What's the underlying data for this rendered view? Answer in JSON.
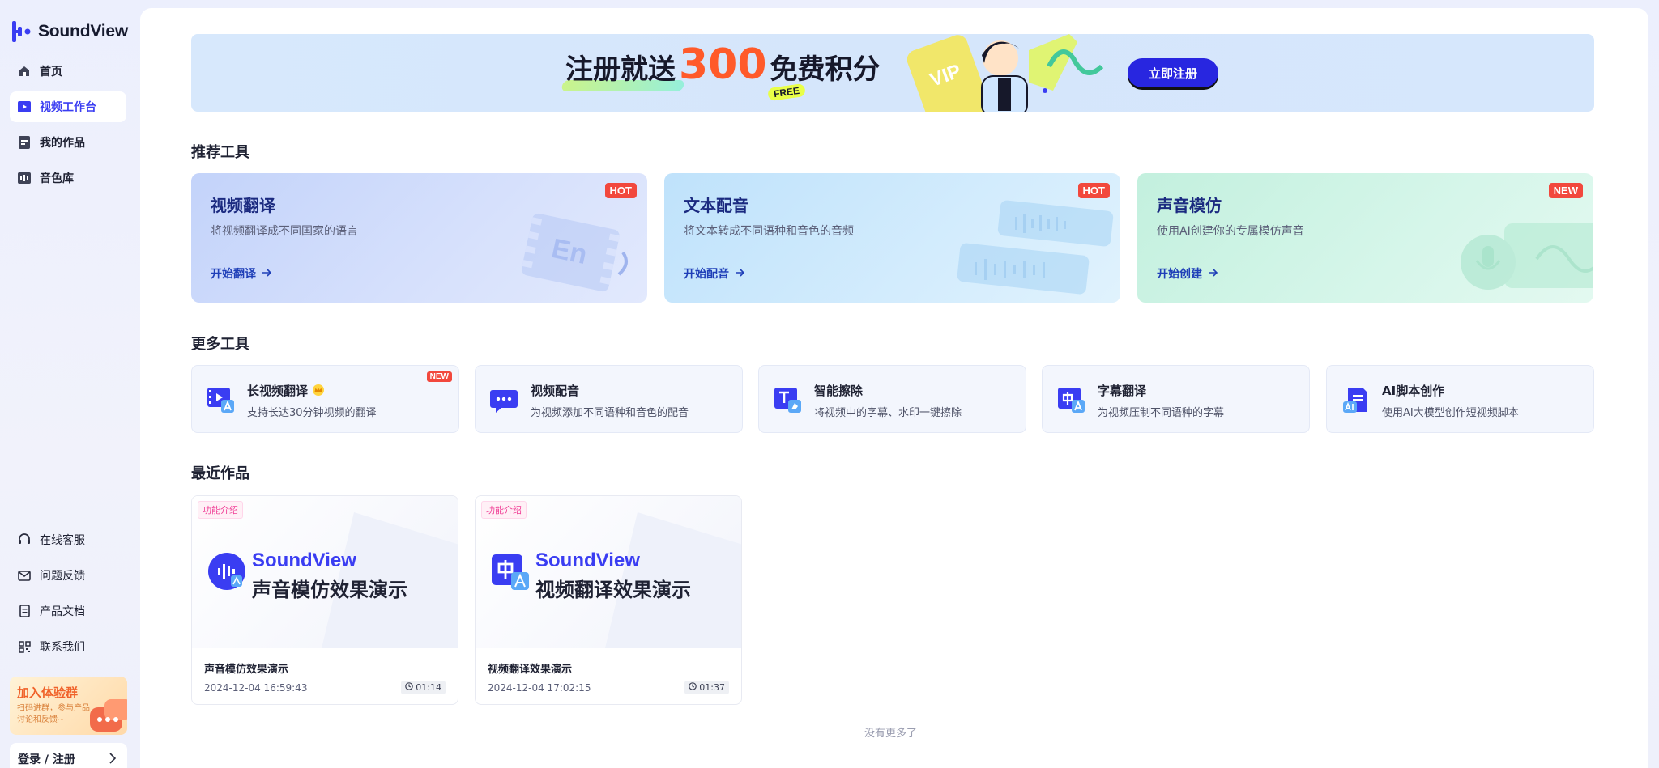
{
  "app": {
    "name": "SoundView"
  },
  "sidebar": {
    "items": [
      {
        "label": "首页",
        "icon": "home-icon"
      },
      {
        "label": "视频工作台",
        "icon": "video-icon",
        "active": true
      },
      {
        "label": "我的作品",
        "icon": "works-icon"
      },
      {
        "label": "音色库",
        "icon": "voice-library-icon"
      }
    ],
    "bottom_items": [
      {
        "label": "在线客服",
        "icon": "headset-icon"
      },
      {
        "label": "问题反馈",
        "icon": "mail-icon"
      },
      {
        "label": "产品文档",
        "icon": "document-icon"
      },
      {
        "label": "联系我们",
        "icon": "qrcode-icon"
      }
    ],
    "join": {
      "title": "加入体验群",
      "desc": "扫码进群，参与产品讨论和反馈~"
    },
    "login": {
      "label": "登录 / 注册"
    }
  },
  "banner": {
    "text_before": "注册就送",
    "number": "300",
    "text_after": "免费积分",
    "free": "FREE",
    "vip": "VIP",
    "button": "立即注册",
    "accent": "#ff5a2a"
  },
  "recommended": {
    "title": "推荐工具",
    "cards": [
      {
        "title": "视频翻译",
        "desc": "将视频翻译成不同国家的语言",
        "link": "开始翻译",
        "badge": "HOT",
        "deco_text": "En"
      },
      {
        "title": "文本配音",
        "desc": "将文本转成不同语种和音色的音频",
        "link": "开始配音",
        "badge": "HOT"
      },
      {
        "title": "声音模仿",
        "desc": "使用AI创建你的专属模仿声音",
        "link": "开始创建",
        "badge": "NEW"
      }
    ]
  },
  "more": {
    "title": "更多工具",
    "tools": [
      {
        "title": "长视频翻译",
        "desc": "支持长达30分钟视频的翻译",
        "badge": "NEW",
        "icon": "long-video-translate-icon"
      },
      {
        "title": "视频配音",
        "desc": "为视频添加不同语种和音色的配音",
        "icon": "video-dubbing-icon"
      },
      {
        "title": "智能擦除",
        "desc": "将视频中的字幕、水印一键擦除",
        "icon": "smart-erase-icon"
      },
      {
        "title": "字幕翻译",
        "desc": "为视频压制不同语种的字幕",
        "icon": "subtitle-translate-icon"
      },
      {
        "title": "AI脚本创作",
        "desc": "使用AI大模型创作短视频脚本",
        "icon": "ai-script-icon"
      }
    ]
  },
  "recent": {
    "title": "最近作品",
    "works": [
      {
        "tag": "功能介绍",
        "brand": "SoundView",
        "subtitle": "声音模仿效果演示",
        "name": "声音模仿效果演示",
        "date": "2024-12-04 16:59:43",
        "duration": "01:14"
      },
      {
        "tag": "功能介绍",
        "brand": "SoundView",
        "subtitle": "视频翻译效果演示",
        "name": "视频翻译效果演示",
        "date": "2024-12-04 17:02:15",
        "duration": "01:37"
      }
    ],
    "empty_text": "没有更多了"
  }
}
